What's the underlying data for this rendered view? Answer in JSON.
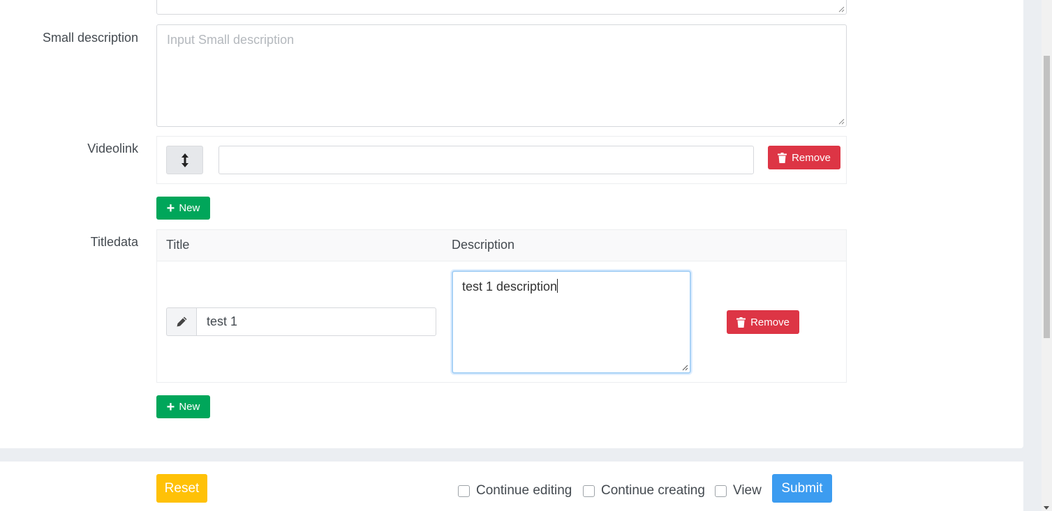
{
  "form": {
    "small_description": {
      "label": "Small description",
      "placeholder": "Input Small description"
    },
    "videolink": {
      "label": "Videolink",
      "value": "",
      "remove_label": "Remove",
      "new_label": "New"
    },
    "titledata": {
      "label": "Titledata",
      "columns": [
        "Title",
        "Description"
      ],
      "rows": [
        {
          "title": "test 1",
          "description": "test 1 description",
          "remove_label": "Remove"
        }
      ],
      "new_label": "New"
    }
  },
  "footer": {
    "reset_label": "Reset",
    "checkboxes": [
      {
        "label": "Continue editing",
        "checked": false
      },
      {
        "label": "Continue creating",
        "checked": false
      },
      {
        "label": "View",
        "checked": false
      }
    ],
    "submit_label": "Submit"
  },
  "icons": {
    "drag": "arrows-vertical-icon",
    "trash": "trash-icon",
    "plus": "plus-icon",
    "pencil": "pencil-icon"
  },
  "colors": {
    "danger": "#dd3545",
    "success": "#00a65a",
    "warning": "#ffc107",
    "primary": "#3c9cf0"
  }
}
